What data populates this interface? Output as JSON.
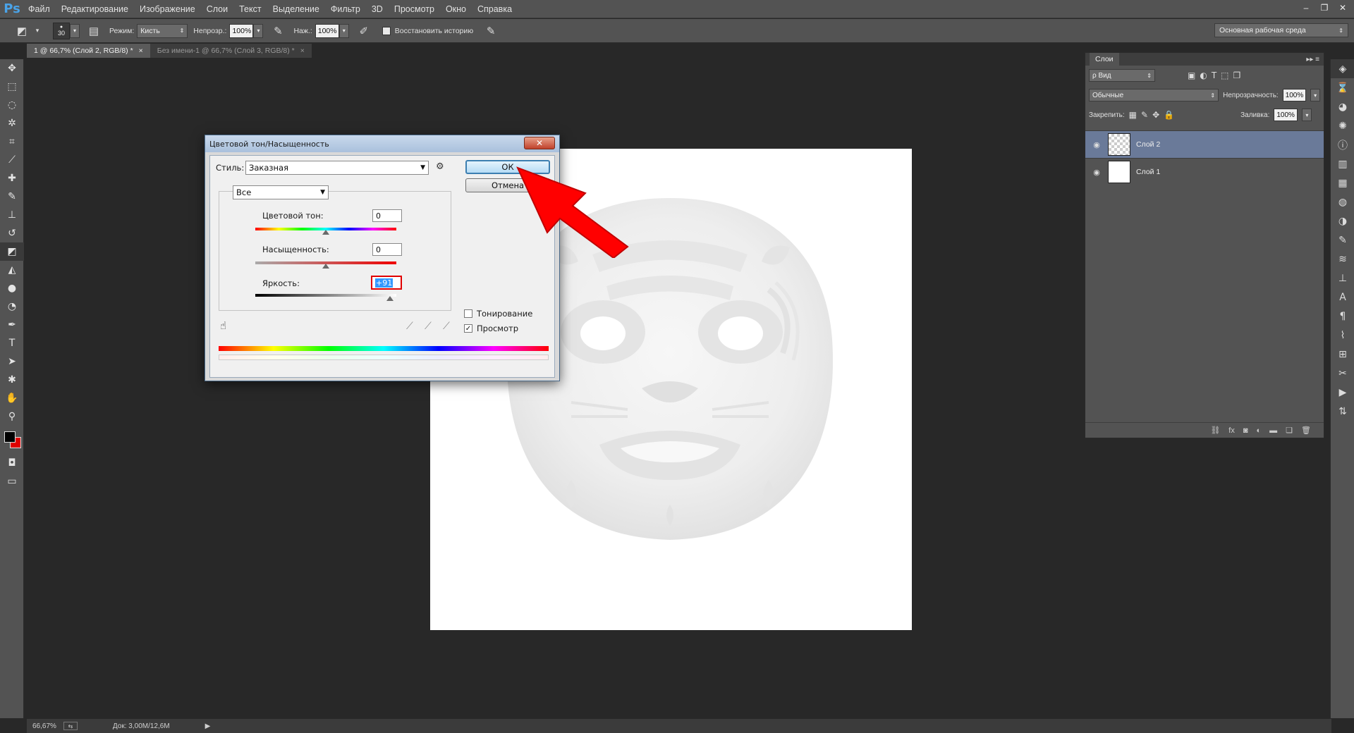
{
  "app": {
    "logo": "Ps",
    "menu": [
      "Файл",
      "Редактирование",
      "Изображение",
      "Слои",
      "Текст",
      "Выделение",
      "Фильтр",
      "3D",
      "Просмотр",
      "Окно",
      "Справка"
    ],
    "window_buttons": [
      "–",
      "❐",
      "✕"
    ]
  },
  "options": {
    "brush_size": "30",
    "mode_label": "Режим:",
    "mode_value": "Кисть",
    "opacity_label": "Непрозр.:",
    "opacity_value": "100%",
    "pressure_label": "Наж.:",
    "pressure_value": "100%",
    "restore_history_label": "Восстановить историю",
    "workspace": "Основная рабочая среда"
  },
  "tabs": [
    {
      "label": "1 @ 66,7% (Слой 2, RGB/8) *",
      "close": "×"
    },
    {
      "label": "Без имени-1 @ 66,7% (Слой 3, RGB/8) *",
      "close": "×"
    }
  ],
  "status": {
    "zoom": "66,67%",
    "doc": "Док: 3,00M/12,6M",
    "arrow": "▶"
  },
  "layers": {
    "tab": "Слои",
    "filter_kind": "ρ Вид",
    "blend_mode": "Обычные",
    "opacity_label": "Непрозрачность:",
    "opacity_value": "100%",
    "lock_label": "Закрепить:",
    "fill_label": "Заливка:",
    "fill_value": "100%",
    "items": [
      {
        "name": "Слой 2",
        "selected": true
      },
      {
        "name": "Слой 1",
        "selected": false
      }
    ]
  },
  "dialog": {
    "title": "Цветовой тон/Насыщенность",
    "close": "✕",
    "style_label": "Стиль:",
    "style_value": "Заказная",
    "ok": "ОК",
    "cancel": "Отмена",
    "channel": "Все",
    "hue_label": "Цветовой тон:",
    "hue_value": "0",
    "saturation_label": "Насыщенность:",
    "saturation_value": "0",
    "lightness_label": "Яркость:",
    "lightness_value": "+91",
    "colorize_label": "Тонирование",
    "colorize_checked": false,
    "preview_label": "Просмотр",
    "preview_checked": true
  },
  "colors": {
    "foreground": "#000000",
    "background": "#e00000",
    "accent_arrow": "#ff0000"
  }
}
